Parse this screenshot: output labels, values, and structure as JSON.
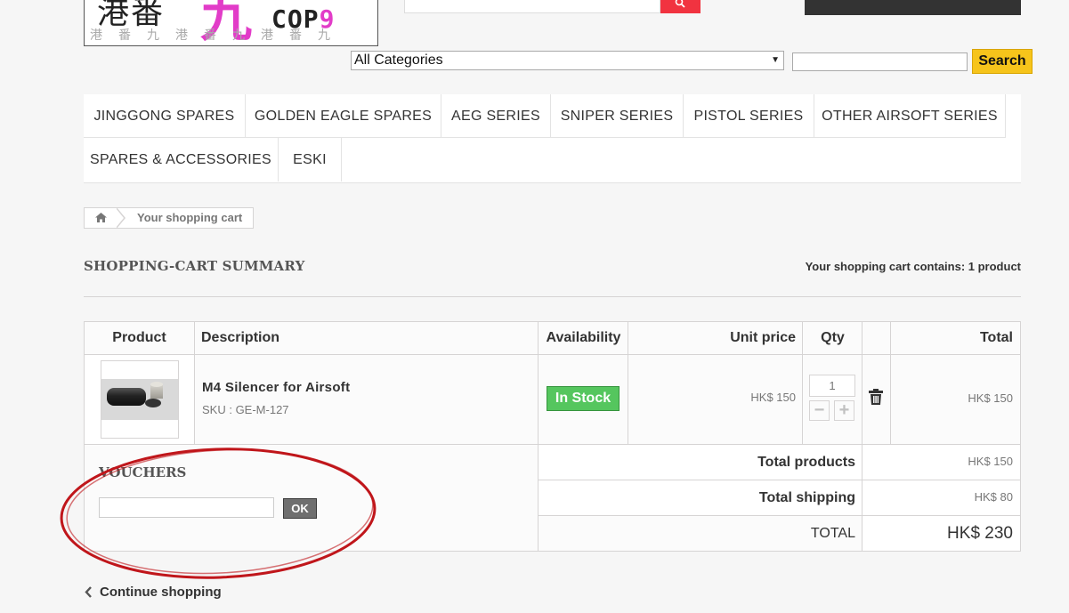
{
  "logo": {
    "chars": "港番",
    "big_char": "九",
    "cop_text": "COP",
    "cop_nine": "9",
    "watermark": "港番九港番九港番九"
  },
  "category_select": {
    "value": "All Categories"
  },
  "search": {
    "button_label": "Search",
    "value": ""
  },
  "menu": {
    "row1": [
      "JINGGONG SPARES",
      "GOLDEN EAGLE SPARES",
      "AEG SERIES",
      "SNIPER SERIES",
      "PISTOL SERIES",
      "OTHER AIRSOFT SERIES"
    ],
    "row2": [
      "SPARES & ACCESSORIES",
      "ESKI"
    ]
  },
  "breadcrumb": {
    "current": "Your shopping cart"
  },
  "page": {
    "title": "SHOPPING-CART SUMMARY",
    "cart_count": "Your shopping cart contains: 1 product"
  },
  "table": {
    "headers": {
      "product": "Product",
      "description": "Description",
      "availability": "Availability",
      "unit_price": "Unit price",
      "qty": "Qty",
      "total": "Total"
    },
    "item": {
      "name": "M4 Silencer for Airsoft",
      "sku": "SKU : GE-M-127",
      "availability": "In Stock",
      "unit_price": "HK$ 150",
      "qty": "1",
      "total": "HK$ 150"
    }
  },
  "vouchers": {
    "title": "VOUCHERS",
    "button_label": "OK",
    "value": ""
  },
  "summary": {
    "total_products_label": "Total products",
    "total_products_value": "HK$ 150",
    "total_shipping_label": "Total shipping",
    "total_shipping_value": "HK$ 80",
    "total_label": "TOTAL",
    "total_value": "HK$ 230"
  },
  "continue": {
    "label": "Continue shopping"
  },
  "colors": {
    "accent_red": "#f13340",
    "search_yellow": "#f6c41b",
    "stock_green": "#55c65e",
    "annotation_red": "#c0161b"
  },
  "icons": [
    "search-icon",
    "home-icon",
    "trash-icon",
    "chevron-left-icon",
    "select-arrow-icon"
  ]
}
